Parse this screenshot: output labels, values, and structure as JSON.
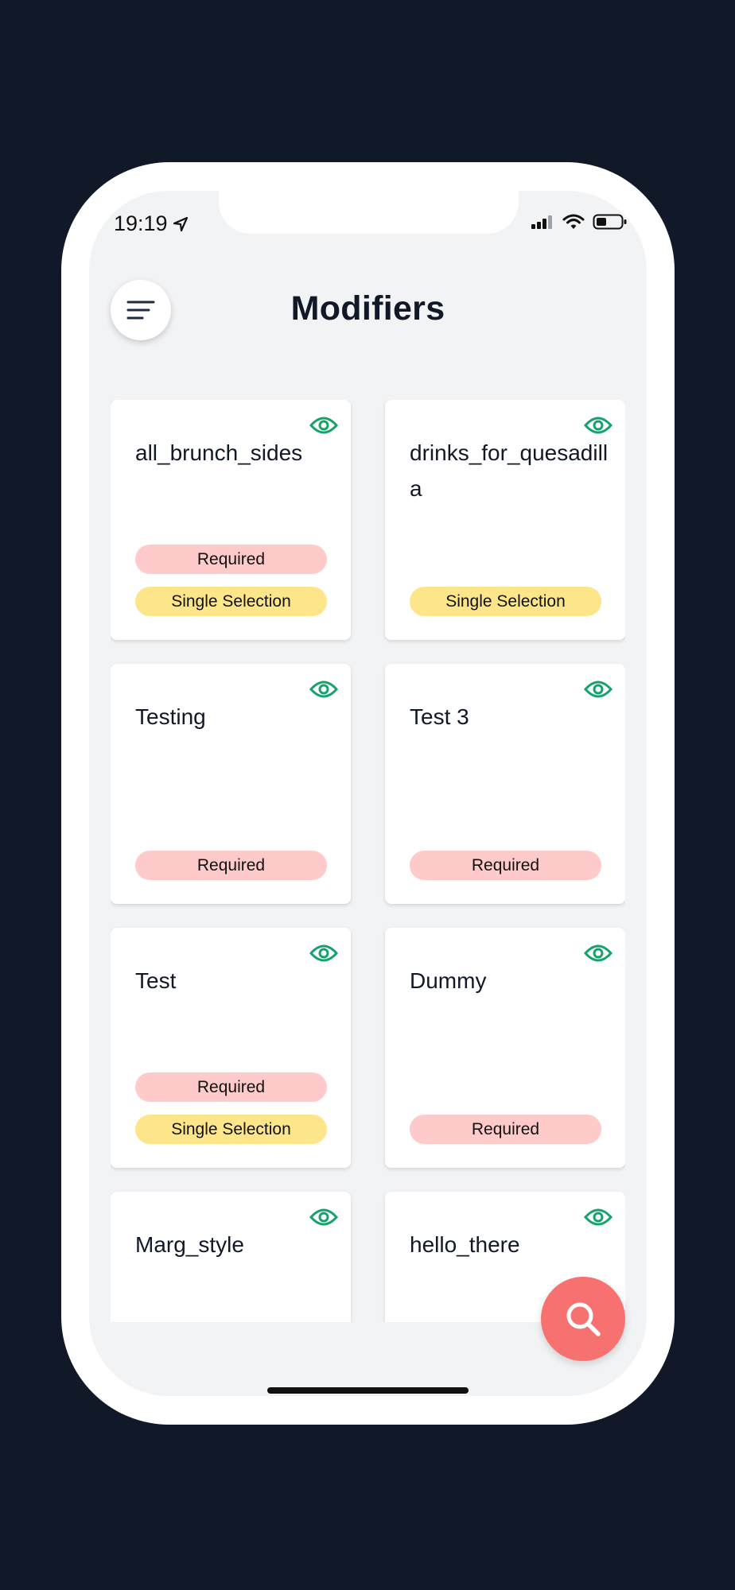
{
  "status_bar": {
    "time": "19:19",
    "icons": [
      "location-arrow-icon",
      "cellular-signal-icon",
      "wifi-icon",
      "battery-icon"
    ]
  },
  "header": {
    "title": "Modifiers",
    "menu_icon": "menu-icon"
  },
  "cards": [
    {
      "title": "all_brunch_sides",
      "visible": true,
      "required_label": "Required",
      "selection_label": "Single Selection"
    },
    {
      "title": "drinks_for_quesadilla",
      "visible": true,
      "required_label": "",
      "selection_label": "Single Selection"
    },
    {
      "title": "Testing",
      "visible": true,
      "required_label": "Required",
      "selection_label": ""
    },
    {
      "title": "Test 3",
      "visible": true,
      "required_label": "Required",
      "selection_label": ""
    },
    {
      "title": "Test",
      "visible": true,
      "required_label": "Required",
      "selection_label": "Single Selection"
    },
    {
      "title": "Dummy",
      "visible": true,
      "required_label": "Required",
      "selection_label": ""
    },
    {
      "title": "Marg_style",
      "visible": true,
      "required_label": "",
      "selection_label": ""
    },
    {
      "title": "hello_there",
      "visible": true,
      "required_label": "",
      "selection_label": ""
    }
  ],
  "fab": {
    "icon": "search-icon"
  },
  "colors": {
    "background": "#111827",
    "screen": "#f2f3f5",
    "required_badge": "#fecaca",
    "single_selection_badge": "#fde68a",
    "eye_icon": "#16a36b",
    "fab": "#f87171"
  }
}
